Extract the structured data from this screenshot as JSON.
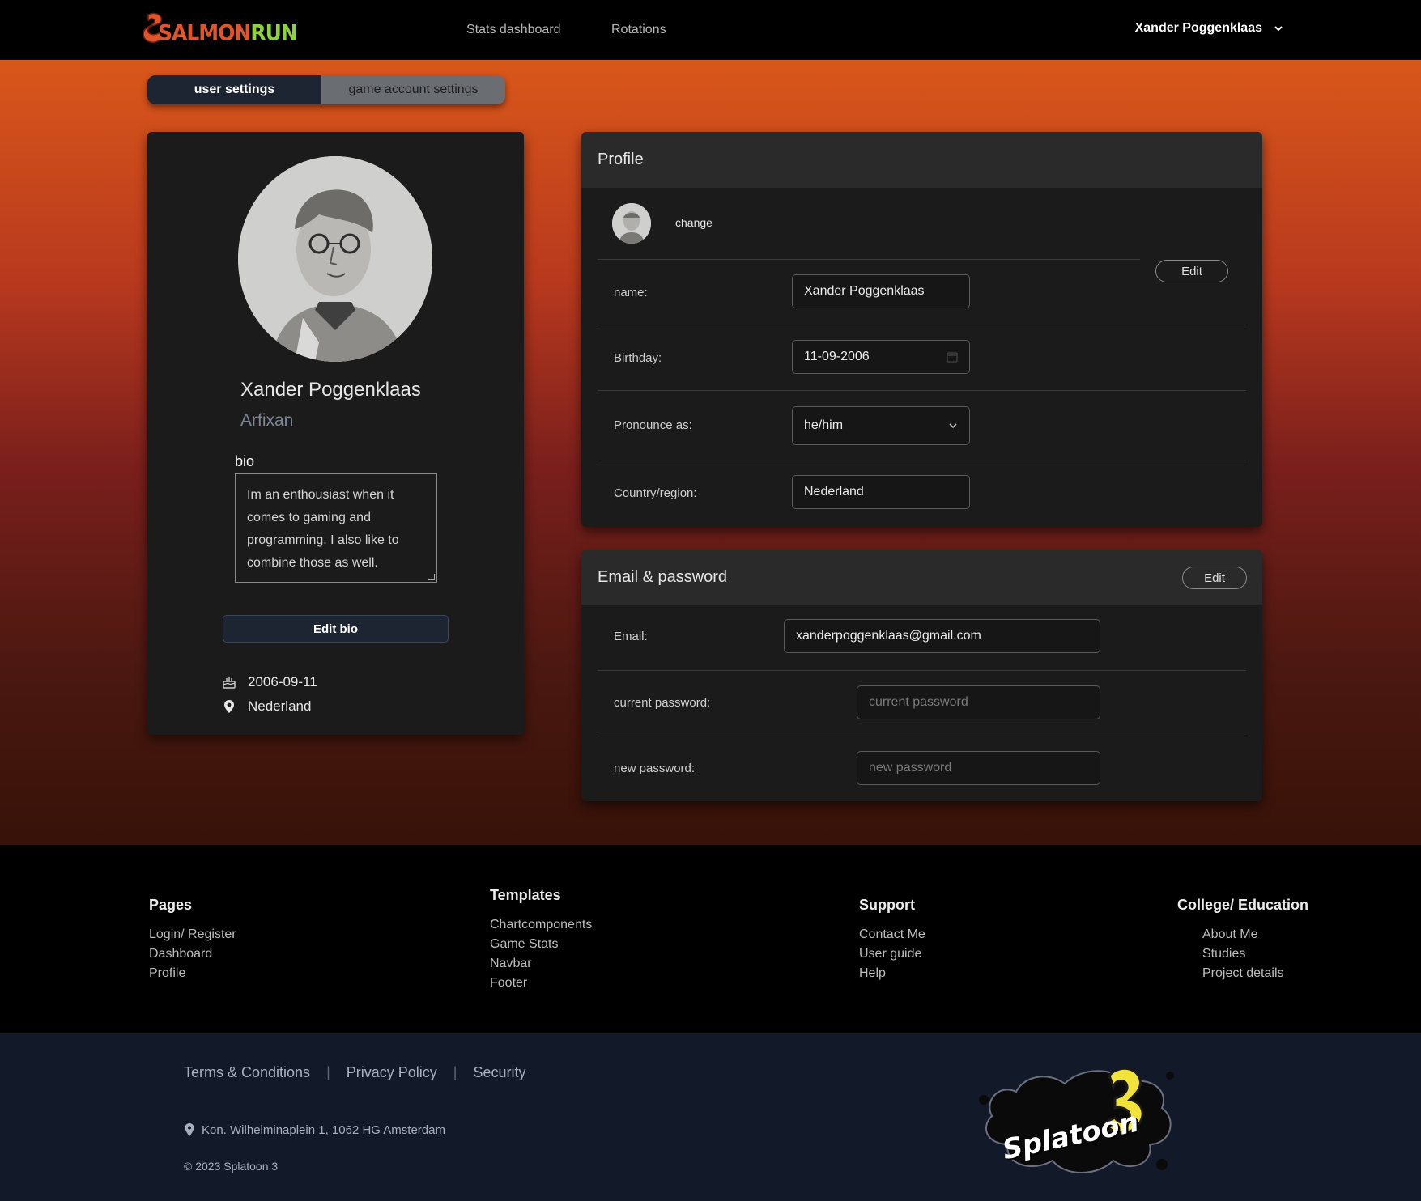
{
  "navbar": {
    "logo_text_salmon": "SALMON",
    "logo_text_run": "RUN",
    "links": [
      "Stats dashboard",
      "Rotations"
    ],
    "user_name": "Xander Poggenklaas"
  },
  "tabs": {
    "active": "user settings",
    "inactive": "game account settings"
  },
  "left_card": {
    "name": "Xander Poggenklaas",
    "handle": "Arfixan",
    "bio_label": "bio",
    "bio_text": "Im an enthousiast when it comes to gaming and programming. I also like to combine those as well.",
    "edit_bio_label": "Edit bio",
    "birthday": "2006-09-11",
    "location": "Nederland"
  },
  "profile": {
    "title": "Profile",
    "change_label": "change",
    "edit_label": "Edit",
    "name_label": "name:",
    "name_value": "Xander Poggenklaas",
    "birthday_label": "Birthday:",
    "birthday_value": "11-09-2006",
    "pronoun_label": "Pronounce as:",
    "pronoun_value": "he/him",
    "country_label": "Country/region:",
    "country_value": "Nederland"
  },
  "email_password": {
    "title": "Email & password",
    "edit_label": "Edit",
    "email_label": "Email:",
    "email_value": "xanderpoggenklaas@gmail.com",
    "current_password_label": "current password:",
    "current_password_placeholder": "current password",
    "new_password_label": "new password:",
    "new_password_placeholder": "new password"
  },
  "footer": {
    "columns": [
      {
        "title": "Pages",
        "links": [
          "Login/ Register",
          "Dashboard",
          "Profile"
        ]
      },
      {
        "title": "Templates",
        "links": [
          "Chartcomponents",
          "Game Stats",
          "Navbar",
          "Footer"
        ]
      },
      {
        "title": "Support",
        "links": [
          "Contact Me",
          "User guide",
          "Help"
        ]
      },
      {
        "title": "College/ Education",
        "links": [
          "About Me",
          "Studies",
          "Project details"
        ]
      }
    ],
    "legal_links": [
      "Terms & Conditions",
      "Privacy Policy",
      "Security"
    ],
    "address": "Kon. Wilhelminaplein 1, 1062 HG Amsterdam",
    "copyright": "© 2023 Splatoon 3",
    "logo_text": "Splatoon 3"
  },
  "colors": {
    "accent_orange": "#d9571a",
    "dark_navy": "#1d2432",
    "card_bg": "#1b1b1b"
  }
}
